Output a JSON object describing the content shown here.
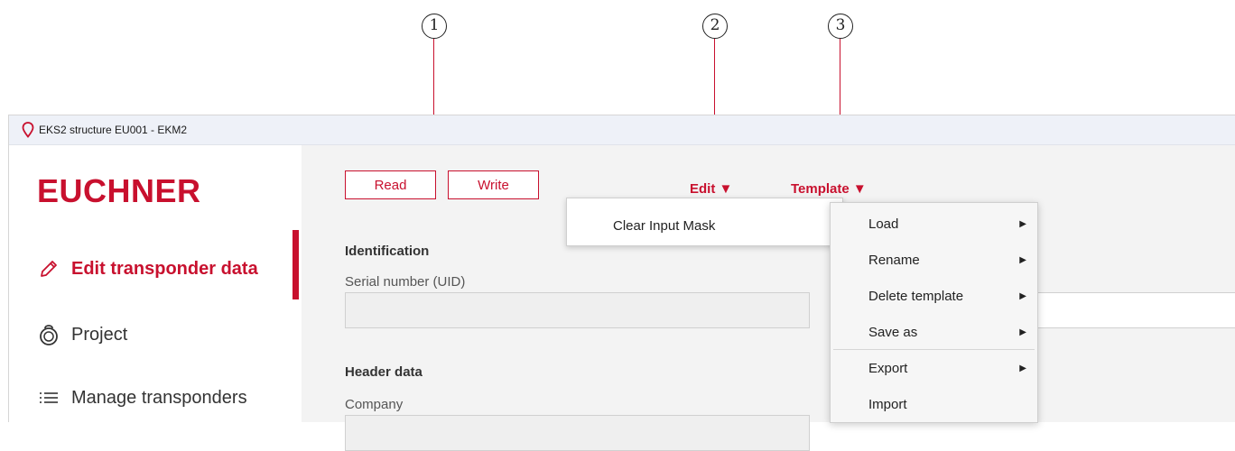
{
  "callouts": [
    "1",
    "2",
    "3"
  ],
  "window": {
    "title": "EKS2 structure EU001 - EKM2",
    "icon": "location-pin-icon",
    "accent_color": "#c8102e"
  },
  "sidebar": {
    "logo": "EUCHNER",
    "items": [
      {
        "label": "Edit transponder data",
        "icon": "pencil-icon",
        "active": true
      },
      {
        "label": "Project",
        "icon": "transponder-tag-icon",
        "active": false
      },
      {
        "label": "Manage transponders",
        "icon": "list-icon",
        "active": false
      }
    ]
  },
  "toolbar": {
    "read_label": "Read",
    "write_label": "Write",
    "edit_label": "Edit ▼",
    "template_label": "Template ▼"
  },
  "edit_menu": {
    "items": [
      "Clear Input Mask"
    ]
  },
  "template_menu": {
    "items": [
      {
        "label": "Load",
        "submenu": true
      },
      {
        "label": "Rename",
        "submenu": true
      },
      {
        "label": "Delete template",
        "submenu": true
      },
      {
        "label": "Save as",
        "submenu": true
      },
      {
        "label": "Export",
        "submenu": true
      },
      {
        "label": "Import",
        "submenu": false
      }
    ]
  },
  "form": {
    "identification_title": "Identification",
    "serial_label": "Serial number (UID)",
    "serial_value": "",
    "header_title": "Header data",
    "company_label": "Company",
    "company_value": ""
  }
}
